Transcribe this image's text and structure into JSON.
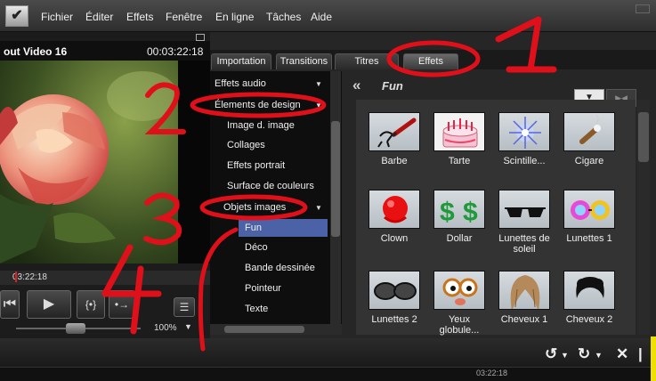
{
  "menubar": {
    "items": [
      "Fichier",
      "Éditer",
      "Effets",
      "Fenêtre",
      "En ligne",
      "Tâches",
      "Aide"
    ]
  },
  "preview": {
    "title": "out Video 16",
    "duration": "00:03:22:18",
    "scrub_time": "03:22:18",
    "zoom": "100%",
    "transport": [
      "previous-icon",
      "play-icon",
      "marker-in-out-icon",
      "marker-next-icon",
      "list-icon"
    ]
  },
  "tabs": [
    "Importation",
    "Transitions",
    "Titres",
    "Effets"
  ],
  "active_tab": "Effets",
  "categories": {
    "top": [
      {
        "label": "Effets audio"
      },
      {
        "label": "Élements de design"
      }
    ],
    "design_items": [
      "Image d. image",
      "Collages",
      "Effets portrait",
      "Surface de couleurs"
    ],
    "objets": {
      "label": "Objets images"
    },
    "objets_items": [
      "Fun",
      "Déco",
      "Bande dessinée",
      "Pointeur",
      "Texte"
    ]
  },
  "effects": {
    "title": "Fun",
    "items": [
      {
        "label": "Barbe"
      },
      {
        "label": "Tarte"
      },
      {
        "label": "Scintille..."
      },
      {
        "label": "Cigare"
      },
      {
        "label": "Clown"
      },
      {
        "label": "Dollar"
      },
      {
        "label": "Lunettes de soleil"
      },
      {
        "label": "Lunettes 1"
      },
      {
        "label": "Lunettes 2"
      },
      {
        "label": "Yeux globule..."
      },
      {
        "label": "Cheveux 1"
      },
      {
        "label": "Cheveux 2"
      }
    ]
  },
  "timeline": {
    "ruler_time": "03:22:18"
  },
  "annotations": [
    "1",
    "2",
    "3",
    "4"
  ],
  "colors": {
    "selection": "#4b63a6",
    "annotation": "#e0101a",
    "background": "#1c1c1c"
  }
}
